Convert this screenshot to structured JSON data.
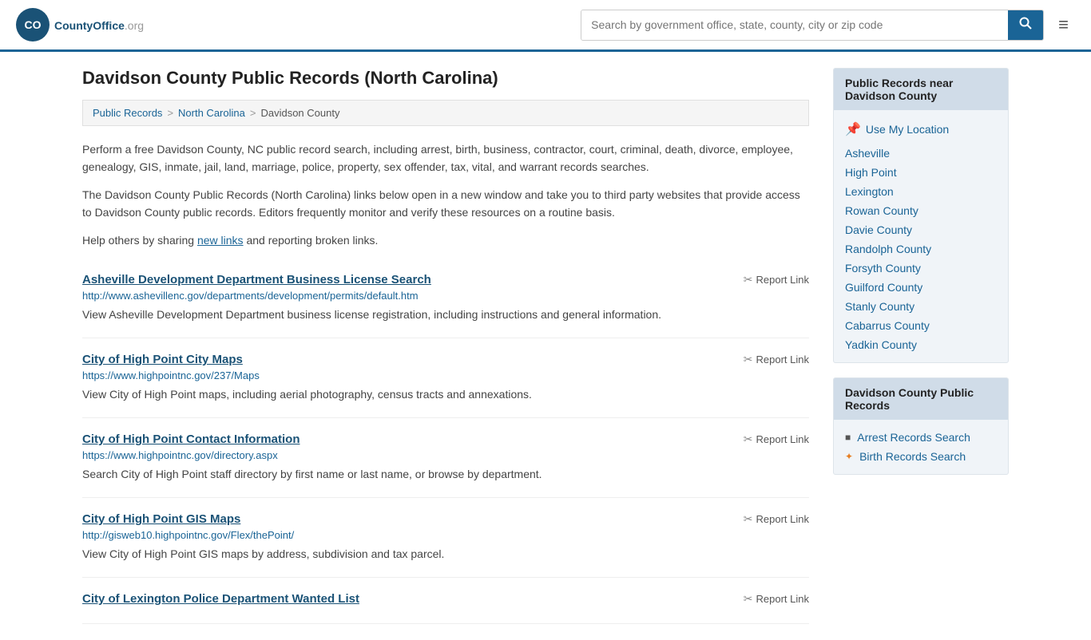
{
  "header": {
    "logo_text": "CountyOffice",
    "logo_suffix": ".org",
    "search_placeholder": "Search by government office, state, county, city or zip code",
    "menu_icon": "≡"
  },
  "page": {
    "title": "Davidson County Public Records (North Carolina)",
    "description1": "Perform a free Davidson County, NC public record search, including arrest, birth, business, contractor, court, criminal, death, divorce, employee, genealogy, GIS, inmate, jail, land, marriage, police, property, sex offender, tax, vital, and warrant records searches.",
    "description2": "The Davidson County Public Records (North Carolina) links below open in a new window and take you to third party websites that provide access to Davidson County public records. Editors frequently monitor and verify these resources on a routine basis.",
    "description3": "Help others by sharing",
    "new_links": "new links",
    "description3_end": "and reporting broken links."
  },
  "breadcrumb": {
    "items": [
      "Public Records",
      "North Carolina",
      "Davidson County"
    ],
    "separators": [
      ">",
      ">"
    ]
  },
  "results": [
    {
      "title": "Asheville Development Department Business License Search",
      "url": "http://www.ashevillenc.gov/departments/development/permits/default.htm",
      "description": "View Asheville Development Department business license registration, including instructions and general information.",
      "report_label": "Report Link"
    },
    {
      "title": "City of High Point City Maps",
      "url": "https://www.highpointnc.gov/237/Maps",
      "description": "View City of High Point maps, including aerial photography, census tracts and annexations.",
      "report_label": "Report Link"
    },
    {
      "title": "City of High Point Contact Information",
      "url": "https://www.highpointnc.gov/directory.aspx",
      "description": "Search City of High Point staff directory by first name or last name, or browse by department.",
      "report_label": "Report Link"
    },
    {
      "title": "City of High Point GIS Maps",
      "url": "http://gisweb10.highpointnc.gov/Flex/thePoint/",
      "description": "View City of High Point GIS maps by address, subdivision and tax parcel.",
      "report_label": "Report Link"
    },
    {
      "title": "City of Lexington Police Department Wanted List",
      "url": "",
      "description": "",
      "report_label": "Report Link"
    }
  ],
  "sidebar": {
    "nearby_title": "Public Records near Davidson County",
    "use_location": "Use My Location",
    "nearby_links": [
      "Asheville",
      "High Point",
      "Lexington",
      "Rowan County",
      "Davie County",
      "Randolph County",
      "Forsyth County",
      "Guilford County",
      "Stanly County",
      "Cabarrus County",
      "Yadkin County"
    ],
    "records_title": "Davidson County Public Records",
    "records_links": [
      "Arrest Records Search",
      "Birth Records Search"
    ]
  }
}
